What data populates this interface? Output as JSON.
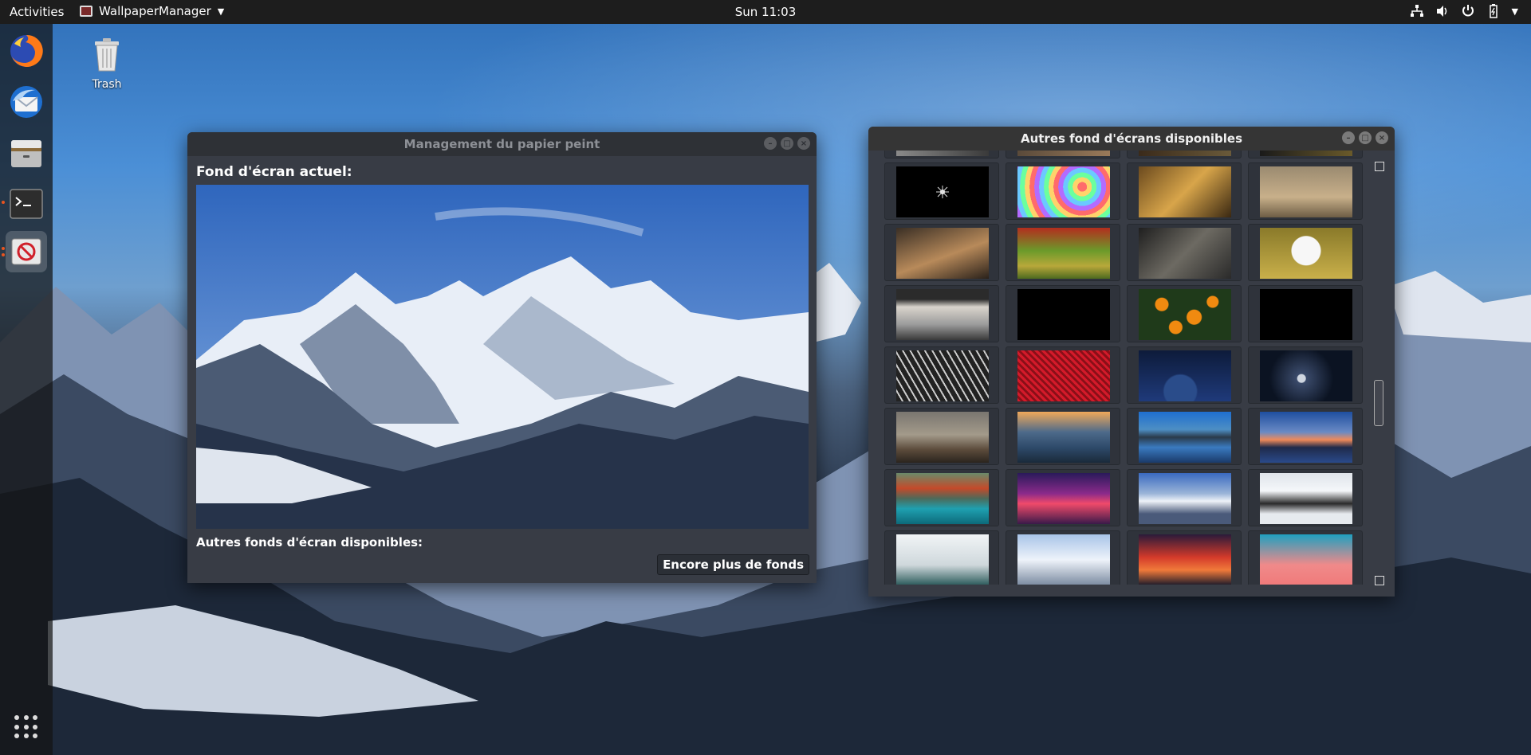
{
  "topbar": {
    "activities": "Activities",
    "app_name": "WallpaperManager",
    "clock": "Sun 11:03"
  },
  "desktop": {
    "trash_label": "Trash"
  },
  "dock": {
    "items": [
      "firefox-icon",
      "thunderbird-icon",
      "files-icon",
      "terminal-icon",
      "wallpaper-manager-icon"
    ]
  },
  "main_window": {
    "title": "Management du papier peint",
    "current_label": "Fond d'écran actuel:",
    "others_label": "Autres fonds d'écran disponibles:",
    "more_button": "Encore plus de fonds"
  },
  "gallery_window": {
    "title": "Autres fond d'écrans disponibles",
    "thumbnails": [
      "partial-top-1",
      "partial-top-2",
      "partial-top-3",
      "partial-top-4",
      "black-star",
      "rainbow-swirl",
      "lion",
      "lioness-lying",
      "lioness-on-log",
      "iguana",
      "lizard-closeup",
      "white-dog",
      "hooded-figure-lake",
      "black",
      "orange-fruits",
      "black",
      "geometric-glass",
      "red-mesh",
      "blue-planet",
      "dark-moon",
      "mountain-valley-sepia",
      "sunset-mountains",
      "lake-reflection-blue",
      "island-lake-sunset",
      "turquoise-lake-mountains",
      "purple-clouds",
      "snowy-peaks-blue",
      "snowy-mountain-dark",
      "snow-scene",
      "snowy-alps",
      "red-sky",
      "pink-sky"
    ]
  },
  "colors": {
    "accent_orange": "#e9541f",
    "window_bg": "#383c45",
    "titlebar": "#2b2e33"
  }
}
